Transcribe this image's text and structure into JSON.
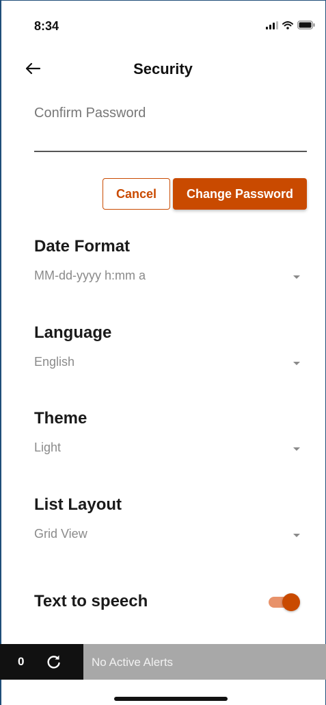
{
  "status_bar": {
    "time": "8:34",
    "icons": [
      "signal-icon",
      "wifi-icon",
      "battery-icon"
    ]
  },
  "header": {
    "title": "Security",
    "back_icon": "arrow-left-icon"
  },
  "password": {
    "confirm_label": "Confirm Password",
    "cancel_label": "Cancel",
    "change_label": "Change Password"
  },
  "settings": {
    "date_format": {
      "label": "Date Format",
      "value": "MM-dd-yyyy h:mm a"
    },
    "language": {
      "label": "Language",
      "value": "English"
    },
    "theme": {
      "label": "Theme",
      "value": "Light"
    },
    "list_layout": {
      "label": "List Layout",
      "value": "Grid View"
    },
    "text_to_speech": {
      "label": "Text to speech",
      "enabled": true
    }
  },
  "alert_bar": {
    "count": "0",
    "refresh_icon": "refresh-icon",
    "message": "No Active Alerts"
  },
  "colors": {
    "accent": "#c94a00",
    "toggle_track": "#e8926a",
    "alert_bar_bg": "#a8a8a8",
    "alert_left_bg": "#111111"
  }
}
